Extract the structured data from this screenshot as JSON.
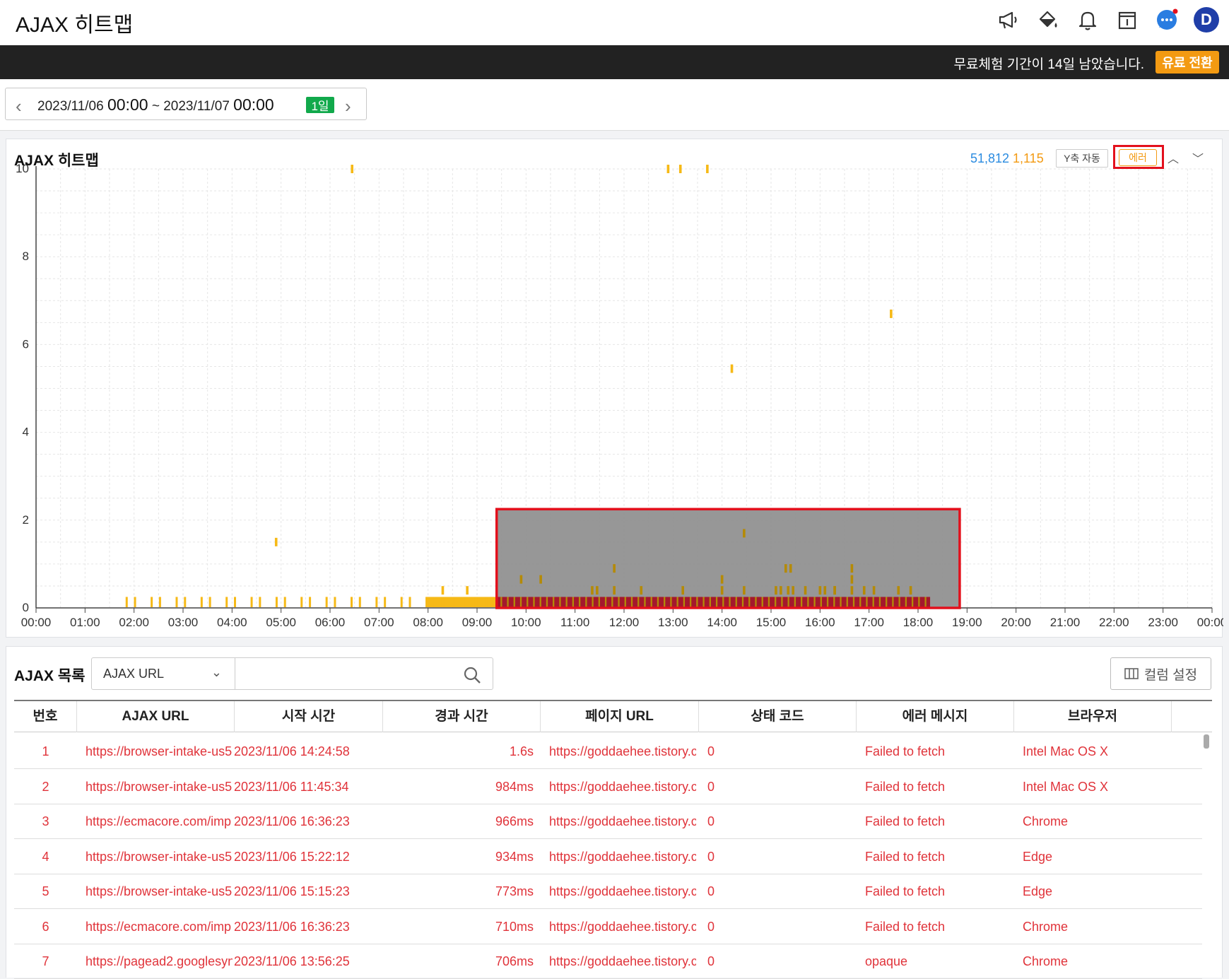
{
  "app": {
    "title": "AJAX 히트맵"
  },
  "header_icons": [
    "megaphone-icon",
    "paint-bucket-icon",
    "bell-icon",
    "calendar-icon",
    "chat-icon"
  ],
  "user": {
    "avatar_letter": "D"
  },
  "trial": {
    "message": "무료체험 기간이 14일 남았습니다.",
    "upgrade_label": "유료 전환"
  },
  "date_range": {
    "start_date": "2023/11/06",
    "start_time": "00:00",
    "sep": "~",
    "end_date": "2023/11/07",
    "end_time": "00:00",
    "period_badge": "1일"
  },
  "heatmap_panel": {
    "title": "AJAX 히트맵",
    "total_count": "51,812",
    "error_count": "1,115",
    "y_axis_toggle": "Y축 자동",
    "error_toggle": "에러"
  },
  "colors": {
    "brand_blue": "#2a8be0",
    "accent_orange": "#f39a12",
    "error_red": "#e0333a",
    "badge_green": "#11a94b",
    "selection_outline": "#e3101c"
  },
  "chart_data": {
    "type": "heatmap",
    "ylim": [
      0,
      10
    ],
    "y_ticks": [
      "0",
      "2",
      "4",
      "6",
      "8",
      "10"
    ],
    "x_ticks": [
      "00:00",
      "01:00",
      "02:00",
      "03:00",
      "04:00",
      "05:00",
      "06:00",
      "07:00",
      "08:00",
      "09:00",
      "10:00",
      "11:00",
      "12:00",
      "13:00",
      "14:00",
      "15:00",
      "16:00",
      "17:00",
      "18:00",
      "19:00",
      "20:00",
      "21:00",
      "22:00",
      "23:00",
      "00:00"
    ],
    "x_unit": "hour of day",
    "y_unit": "seconds",
    "grid": true,
    "selection": {
      "x_range": [
        9.4,
        18.85
      ],
      "y_range": [
        0,
        2.25
      ]
    },
    "points": [
      {
        "x": 6.45,
        "y": 10,
        "level": "low"
      },
      {
        "x": 12.9,
        "y": 10,
        "level": "low"
      },
      {
        "x": 13.15,
        "y": 10,
        "level": "low"
      },
      {
        "x": 13.7,
        "y": 10,
        "level": "low"
      },
      {
        "x": 17.45,
        "y": 6.7,
        "level": "low"
      },
      {
        "x": 14.2,
        "y": 5.45,
        "level": "low"
      },
      {
        "x": 4.9,
        "y": 1.5,
        "level": "low"
      },
      {
        "x": 14.45,
        "y": 1.7,
        "level": "mid"
      },
      {
        "x": 11.8,
        "y": 0.9,
        "level": "mid"
      },
      {
        "x": 15.3,
        "y": 0.9,
        "level": "mid"
      },
      {
        "x": 15.4,
        "y": 0.9,
        "level": "mid"
      },
      {
        "x": 16.65,
        "y": 0.9,
        "level": "mid"
      },
      {
        "x": 9.9,
        "y": 0.65,
        "level": "mid"
      },
      {
        "x": 10.3,
        "y": 0.65,
        "level": "mid"
      },
      {
        "x": 14.0,
        "y": 0.65,
        "level": "mid"
      },
      {
        "x": 16.65,
        "y": 0.65,
        "level": "mid"
      },
      {
        "x": 8.3,
        "y": 0.4,
        "level": "low"
      },
      {
        "x": 8.8,
        "y": 0.4,
        "level": "low"
      },
      {
        "x": 11.35,
        "y": 0.4,
        "level": "mid"
      },
      {
        "x": 11.45,
        "y": 0.4,
        "level": "mid"
      },
      {
        "x": 11.8,
        "y": 0.4,
        "level": "mid"
      },
      {
        "x": 12.35,
        "y": 0.4,
        "level": "mid"
      },
      {
        "x": 13.2,
        "y": 0.4,
        "level": "mid"
      },
      {
        "x": 14.0,
        "y": 0.4,
        "level": "mid"
      },
      {
        "x": 14.45,
        "y": 0.4,
        "level": "mid"
      },
      {
        "x": 15.1,
        "y": 0.4,
        "level": "mid"
      },
      {
        "x": 15.2,
        "y": 0.4,
        "level": "mid"
      },
      {
        "x": 15.35,
        "y": 0.4,
        "level": "mid"
      },
      {
        "x": 15.45,
        "y": 0.4,
        "level": "mid"
      },
      {
        "x": 15.7,
        "y": 0.4,
        "level": "mid"
      },
      {
        "x": 16.0,
        "y": 0.4,
        "level": "mid"
      },
      {
        "x": 16.1,
        "y": 0.4,
        "level": "mid"
      },
      {
        "x": 16.3,
        "y": 0.4,
        "level": "mid"
      },
      {
        "x": 16.3,
        "y": 0.4,
        "level": "mid"
      },
      {
        "x": 16.65,
        "y": 0.4,
        "level": "mid"
      },
      {
        "x": 16.9,
        "y": 0.4,
        "level": "mid"
      },
      {
        "x": 17.1,
        "y": 0.4,
        "level": "mid"
      },
      {
        "x": 17.6,
        "y": 0.4,
        "level": "mid"
      },
      {
        "x": 17.85,
        "y": 0.4,
        "level": "mid"
      }
    ],
    "baseline_segments": [
      {
        "x_from": 1.85,
        "x_to": 8.0,
        "level": "low",
        "sparse": true
      },
      {
        "x_from": 8.0,
        "x_to": 9.4,
        "level": "low",
        "sparse": false
      },
      {
        "x_from": 9.4,
        "x_to": 18.25,
        "level": "high",
        "sparse": false
      }
    ]
  },
  "list_panel": {
    "title": "AJAX 목록",
    "field_select": "AJAX URL",
    "search_value": "",
    "column_settings_label": "컬럼 설정"
  },
  "table": {
    "columns": [
      "번호",
      "AJAX URL",
      "시작 시간",
      "경과 시간",
      "페이지 URL",
      "상태 코드",
      "에러 메시지",
      "브라우저"
    ],
    "rows": [
      {
        "no": "1",
        "ajax_url": "https://browser-intake-us5-",
        "start": "2023/11/06 14:24:58",
        "elapsed": "1.6s",
        "page_url": "https://goddaehee.tistory.c",
        "status": "0",
        "error": "Failed to fetch",
        "browser": "Intel Mac OS X"
      },
      {
        "no": "2",
        "ajax_url": "https://browser-intake-us5-",
        "start": "2023/11/06 11:45:34",
        "elapsed": "984ms",
        "page_url": "https://goddaehee.tistory.c",
        "status": "0",
        "error": "Failed to fetch",
        "browser": "Intel Mac OS X"
      },
      {
        "no": "3",
        "ajax_url": "https://ecmacore.com/imp",
        "start": "2023/11/06 16:36:23",
        "elapsed": "966ms",
        "page_url": "https://goddaehee.tistory.c",
        "status": "0",
        "error": "Failed to fetch",
        "browser": "Chrome"
      },
      {
        "no": "4",
        "ajax_url": "https://browser-intake-us5-",
        "start": "2023/11/06 15:22:12",
        "elapsed": "934ms",
        "page_url": "https://goddaehee.tistory.c",
        "status": "0",
        "error": "Failed to fetch",
        "browser": "Edge"
      },
      {
        "no": "5",
        "ajax_url": "https://browser-intake-us5-",
        "start": "2023/11/06 15:15:23",
        "elapsed": "773ms",
        "page_url": "https://goddaehee.tistory.c",
        "status": "0",
        "error": "Failed to fetch",
        "browser": "Edge"
      },
      {
        "no": "6",
        "ajax_url": "https://ecmacore.com/imp",
        "start": "2023/11/06 16:36:23",
        "elapsed": "710ms",
        "page_url": "https://goddaehee.tistory.c",
        "status": "0",
        "error": "Failed to fetch",
        "browser": "Chrome"
      },
      {
        "no": "7",
        "ajax_url": "https://pagead2.googlesyn",
        "start": "2023/11/06 13:56:25",
        "elapsed": "706ms",
        "page_url": "https://goddaehee.tistory.c",
        "status": "0",
        "error": "opaque",
        "browser": "Chrome"
      }
    ]
  }
}
